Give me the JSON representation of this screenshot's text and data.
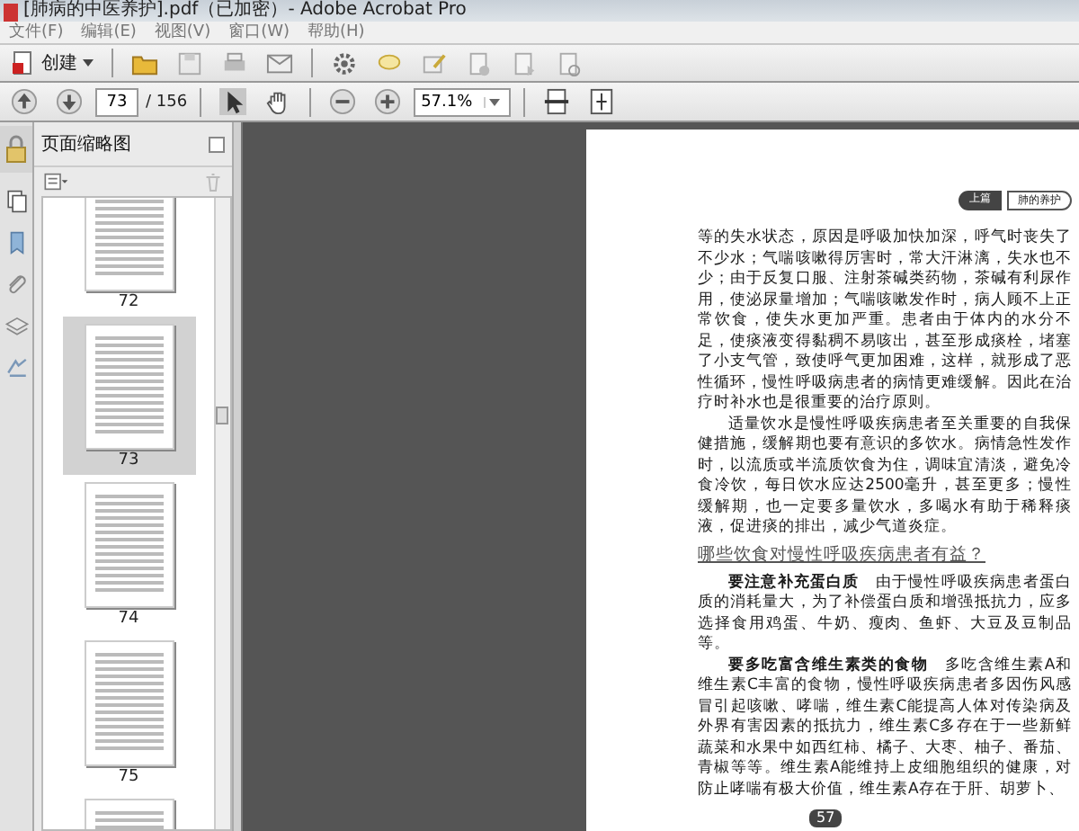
{
  "window": {
    "title": "[肺病的中医养护].pdf（已加密）- Adobe Acrobat Pro"
  },
  "menu": [
    "文件(F)",
    "编辑(E)",
    "视图(V)",
    "窗口(W)",
    "帮助(H)"
  ],
  "toolbar": {
    "create_label": "创建",
    "page_number": "73",
    "page_total": "/ 156",
    "zoom": "57.1%"
  },
  "panel": {
    "title": "页面缩略图",
    "thumbnails": [
      {
        "label": "72",
        "selected": false
      },
      {
        "label": "73",
        "selected": true
      },
      {
        "label": "74",
        "selected": false
      },
      {
        "label": "75",
        "selected": false
      },
      {
        "selected": false
      }
    ]
  },
  "page": {
    "header_tag": [
      "上篇",
      "肺的养护"
    ],
    "paragraphs": [
      {
        "kind": "body",
        "indent": false,
        "text": "等的失水状态，原因是呼吸加快加深，呼气时丧失了不少水；气喘咳嗽得厉害时，常大汗淋漓，失水也不少；由于反复口服、注射茶碱类药物，茶碱有利尿作用，使泌尿量增加；气喘咳嗽发作时，病人顾不上正常饮食，使失水更加严重。患者由于体内的水分不足，使痰液变得黏稠不易咳出，甚至形成痰栓，堵塞了小支气管，致使呼气更加困难，这样，就形成了恶性循环，慢性呼吸病患者的病情更难缓解。因此在治疗时补水也是很重要的治疗原则。"
      },
      {
        "kind": "body",
        "indent": true,
        "text": "适量饮水是慢性呼吸疾病患者至关重要的自我保健措施，缓解期也要有意识的多饮水。病情急性发作时，以流质或半流质饮食为住，调味宜清淡，避免冷食冷饮，每日饮水应达2500毫升，甚至更多；慢性缓解期，也一定要多量饮水，多喝水有助于稀释痰液，促进痰的排出，减少气道炎症。"
      },
      {
        "kind": "heading",
        "text": "哪些饮食对慢性呼吸疾病患者有益？"
      },
      {
        "kind": "body",
        "indent": true,
        "text": "**要注意补充蛋白质**　由于慢性呼吸疾病患者蛋白质的消耗量大，为了补偿蛋白质和增强抵抗力，应多选择食用鸡蛋、牛奶、瘦肉、鱼虾、大豆及豆制品等。"
      },
      {
        "kind": "body",
        "indent": true,
        "text": "**要多吃富含维生素类的食物**　多吃含维生素A和维生素C丰富的食物，慢性呼吸疾病患者多因伤风感冒引起咳嗽、哮喘，维生素C能提高人体对传染病及外界有害因素的抵抗力，维生素C多存在于一些新鲜蔬菜和水果中如西红柿、橘子、大枣、柚子、番茄、青椒等等。维生素A能维持上皮细胞组织的健康，对防止哮喘有极大价值，维生素A存在于肝、胡萝卜、"
      }
    ],
    "page_number": "57"
  }
}
